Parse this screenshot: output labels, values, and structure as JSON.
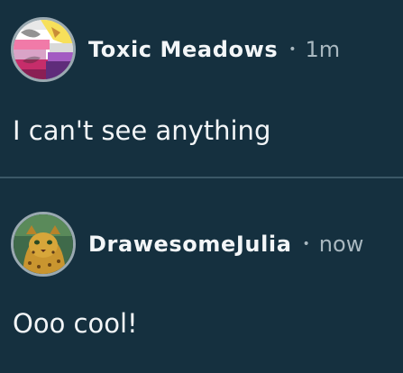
{
  "posts": [
    {
      "username": "Toxic Meadows",
      "separator": "•",
      "time": "1m",
      "text": "I can't see anything",
      "avatar_icon": "pride-flag-collage-avatar"
    },
    {
      "username": "DrawesomeJulia",
      "separator": "•",
      "time": "now",
      "text": "Ooo cool!",
      "avatar_icon": "jaguar-avatar"
    }
  ],
  "colors": {
    "background": "#15303f",
    "divider": "#3b5867",
    "text": "#f2f5f7",
    "muted": "#a9b8c0"
  }
}
